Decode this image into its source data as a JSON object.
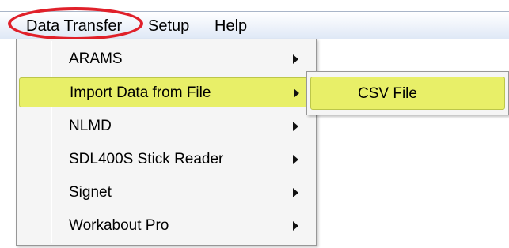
{
  "menubar": {
    "items": [
      {
        "label": "Data Transfer"
      },
      {
        "label": "Setup"
      },
      {
        "label": "Help"
      }
    ]
  },
  "dropdown": {
    "items": [
      {
        "label": "ARAMS",
        "has_submenu": true
      },
      {
        "label": "Import Data from File",
        "has_submenu": true,
        "highlighted": true
      },
      {
        "label": "NLMD",
        "has_submenu": true
      },
      {
        "label": "SDL400S Stick Reader",
        "has_submenu": true
      },
      {
        "label": "Signet",
        "has_submenu": true
      },
      {
        "label": "Workabout Pro",
        "has_submenu": true
      }
    ]
  },
  "submenu": {
    "items": [
      {
        "label": "CSV File",
        "highlighted": true
      }
    ]
  },
  "colors": {
    "highlight": "#e8ef68",
    "annotation_circle": "#e0202a",
    "menu_background": "#f5f5f5"
  }
}
